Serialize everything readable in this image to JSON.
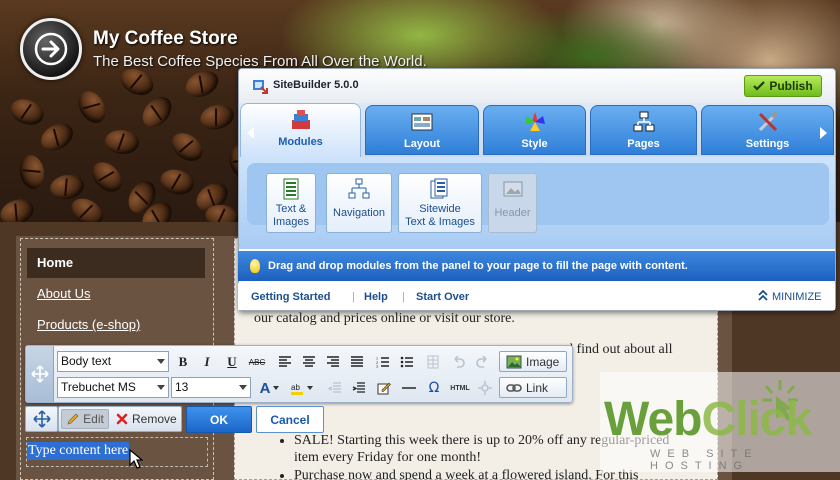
{
  "site": {
    "title": "My Coffee Store",
    "subtitle": "The Best Coffee Species From All Over the World."
  },
  "nav": {
    "items": [
      {
        "label": "Home"
      },
      {
        "label": "About Us"
      },
      {
        "label": "Products (e-shop)"
      }
    ]
  },
  "content": {
    "line1": "our catalog and prices online or visit our store.",
    "line2a": "d find out about all",
    "bullets": [
      "SALE! Starting this week there is up to 20% off any regular-priced item every Friday for one month!",
      "Purchase now and spend a week at a flowered island. For this"
    ]
  },
  "sitebuilder": {
    "title": "SiteBuilder 5.0.0",
    "publish_label": "Publish",
    "tabs": [
      {
        "label": "Modules"
      },
      {
        "label": "Layout"
      },
      {
        "label": "Style"
      },
      {
        "label": "Pages"
      },
      {
        "label": "Settings"
      }
    ],
    "modules": [
      {
        "label_line1": "Text &",
        "label_line2": "Images"
      },
      {
        "label_line1": "Navigation",
        "label_line2": ""
      },
      {
        "label_line1": "Sitewide",
        "label_line2": "Text & Images"
      },
      {
        "label_line1": "Header",
        "label_line2": ""
      }
    ],
    "info": "Drag and drop modules from the panel to your page to fill the page with content.",
    "footer": {
      "getting_started": "Getting Started",
      "help": "Help",
      "start_over": "Start Over",
      "minimize": "MINIMIZE"
    }
  },
  "editor": {
    "style_select": "Body text",
    "font_select": "Trebuchet MS",
    "size_select": "13",
    "image_label": "Image",
    "link_label": "Link",
    "bold": "B",
    "italic": "I",
    "underline": "U",
    "strike": "ABC",
    "omega": "Ω",
    "html": "HTML",
    "edit_label": "Edit",
    "remove_label": "Remove",
    "ok_label": "OK",
    "cancel_label": "Cancel",
    "selected_text": "Type content here"
  },
  "watermark": {
    "brand_a": "Web",
    "brand_b": "Click",
    "tagline": "WEB SITE HOSTING"
  },
  "colors": {
    "accent_blue": "#2f7fd8",
    "publish_green": "#6fbd1c",
    "nav_dark": "#3c2b1f"
  }
}
